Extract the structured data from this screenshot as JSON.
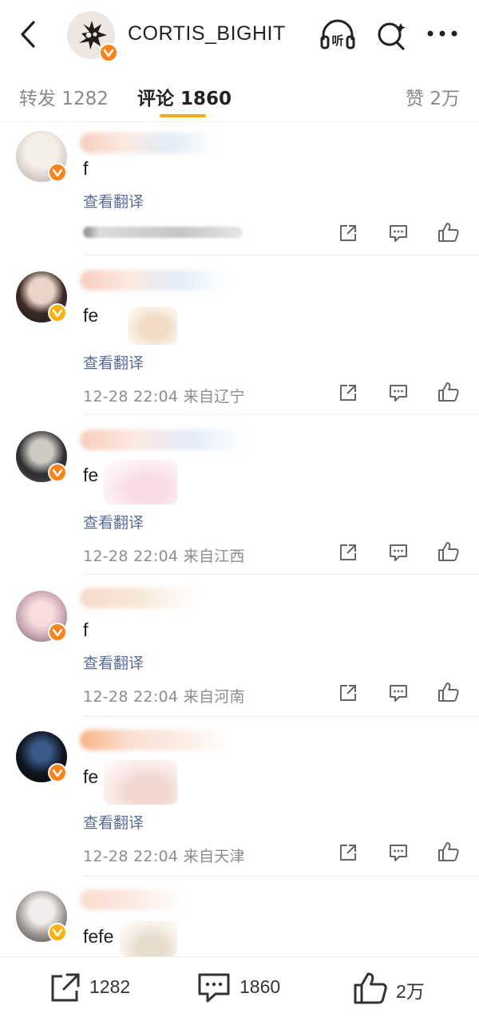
{
  "header": {
    "title": "CORTIS_BIGHIT",
    "colors": {
      "verified_orange": "#f5841f",
      "verified_gold": "#f5b316",
      "tab_indicator": "#f5a623",
      "translate_link": "#5a6c9a"
    }
  },
  "tabs": [
    {
      "label": "转发 1282",
      "active": false
    },
    {
      "label": "评论 1860",
      "active": true
    },
    {
      "label": "赞 2万",
      "active": false
    }
  ],
  "comments": [
    {
      "text": "f",
      "translate": "查看翻译",
      "meta": "",
      "badge": "orange"
    },
    {
      "text": "fe",
      "translate": "查看翻译",
      "meta": "12-28 22:04  来自辽宁",
      "badge": "gold"
    },
    {
      "text": "fe",
      "translate": "查看翻译",
      "meta": "12-28 22:04  来自江西",
      "badge": "orange"
    },
    {
      "text": "f",
      "translate": "查看翻译",
      "meta": "12-28 22:04  来自河南",
      "badge": "orange"
    },
    {
      "text": "fe",
      "translate": "查看翻译",
      "meta": "12-28 22:04  来自天津",
      "badge": "orange"
    },
    {
      "text": "fefe",
      "translate": "",
      "meta": "",
      "badge": "gold"
    }
  ],
  "bottom_bar": {
    "repost_count": "1282",
    "comment_count": "1860",
    "like_count": "2万"
  }
}
